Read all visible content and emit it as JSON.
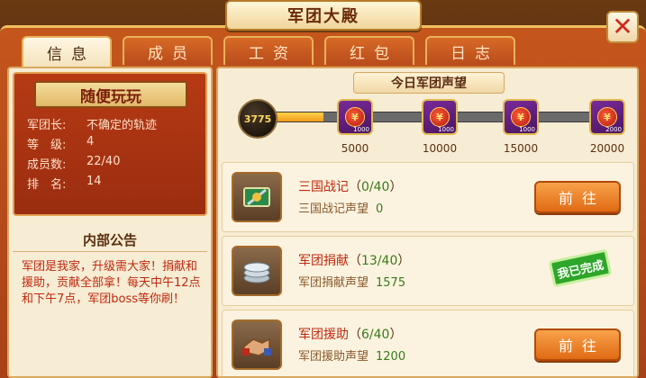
{
  "window": {
    "title": "军团大殿",
    "close_glyph": "✕"
  },
  "tabs": [
    {
      "label": "信息",
      "active": true
    },
    {
      "label": "成员",
      "active": false
    },
    {
      "label": "工资",
      "active": false
    },
    {
      "label": "红包",
      "active": false
    },
    {
      "label": "日志",
      "active": false
    }
  ],
  "legion": {
    "name": "随便玩玩",
    "rows": [
      {
        "label": "军团长:",
        "value": "不确定的轨迹"
      },
      {
        "label": "等　级:",
        "value": "4"
      },
      {
        "label": "成员数:",
        "value": "22/40"
      },
      {
        "label": "排　名:",
        "value": "14"
      }
    ]
  },
  "notice": {
    "title": "内部公告",
    "text": "军团是我家，升级需大家！捐献和援助，贡献全部拿！每天中午12点和下午7点，军团boss等你刷！"
  },
  "reputation": {
    "title": "今日军团声望",
    "current": "3775",
    "current_value": 3775,
    "max_value": 20000,
    "milestones": [
      {
        "label": "5000",
        "value": 5000,
        "reward_qty": "1000"
      },
      {
        "label": "10000",
        "value": 10000,
        "reward_qty": "1000"
      },
      {
        "label": "15000",
        "value": 15000,
        "reward_qty": "1000"
      },
      {
        "label": "20000",
        "value": 20000,
        "reward_qty": "2000"
      }
    ],
    "reward_glyph": "¥"
  },
  "tasks": [
    {
      "title": "三国战记",
      "progress": "0/40",
      "sub_label": "三国战记声望",
      "sub_value": "0",
      "action": "前往",
      "completed": false,
      "icon": "war-chronicle-icon"
    },
    {
      "title": "军团捐献",
      "progress": "13/40",
      "sub_label": "军团捐献声望",
      "sub_value": "1575",
      "action": "",
      "completed": true,
      "done_label": "我已完成",
      "icon": "silver-coins-icon"
    },
    {
      "title": "军团援助",
      "progress": "6/40",
      "sub_label": "军团援助声望",
      "sub_value": "1200",
      "action": "前往",
      "completed": false,
      "icon": "handshake-icon"
    }
  ],
  "colors": {
    "accent": "#e06a14",
    "frame": "#b84c1c",
    "panel": "#f7ecd4",
    "done": "#2ea62a"
  }
}
